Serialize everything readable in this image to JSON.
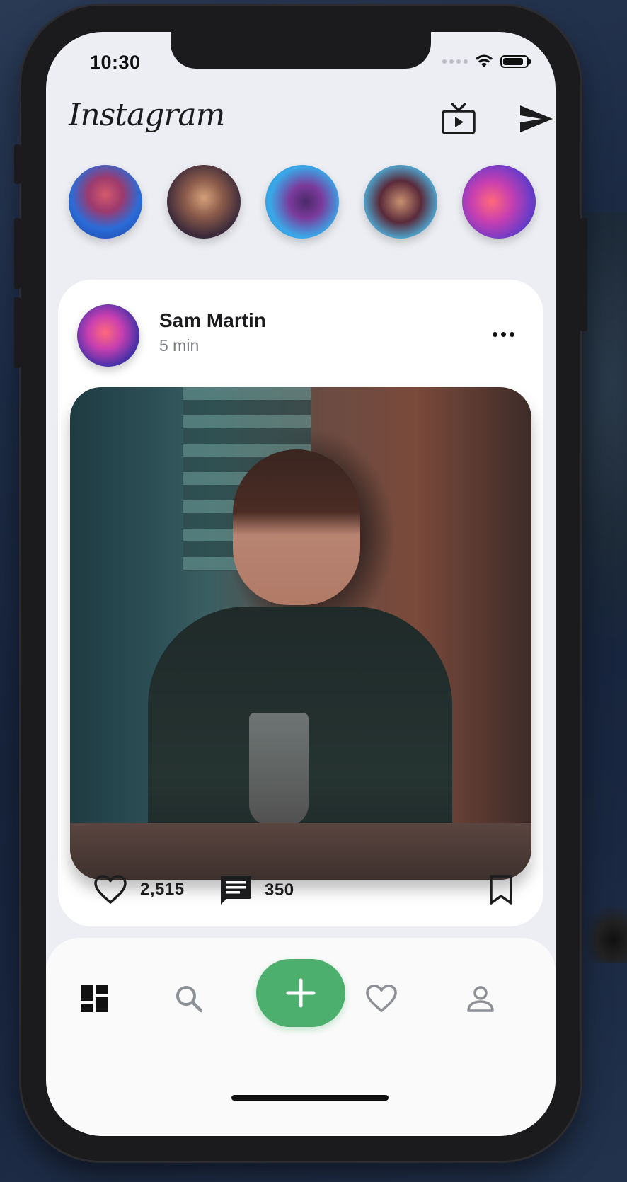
{
  "status_bar": {
    "time": "10:30"
  },
  "header": {
    "logo_text": "Instagram",
    "tv_icon": "tv-icon",
    "send_icon": "send-icon"
  },
  "stories": [
    {
      "name": "story-1",
      "colors": [
        "#2b6cd8",
        "#c84a6b"
      ]
    },
    {
      "name": "story-2",
      "colors": [
        "#3b2a3a",
        "#d4a07a"
      ]
    },
    {
      "name": "story-3",
      "colors": [
        "#3aa8e8",
        "#7b3a9c"
      ]
    },
    {
      "name": "story-4",
      "colors": [
        "#5a2a3a",
        "#4fa0c8"
      ]
    },
    {
      "name": "story-5",
      "colors": [
        "#6a3cc8",
        "#ff6a7a"
      ]
    }
  ],
  "post": {
    "author": "Sam Martin",
    "time_ago": "5 min",
    "likes": "2,515",
    "comments": "350"
  },
  "bottom_nav": {
    "items": [
      "dashboard",
      "search",
      "add",
      "favorites",
      "profile"
    ],
    "accent_color": "#4caf6d"
  }
}
